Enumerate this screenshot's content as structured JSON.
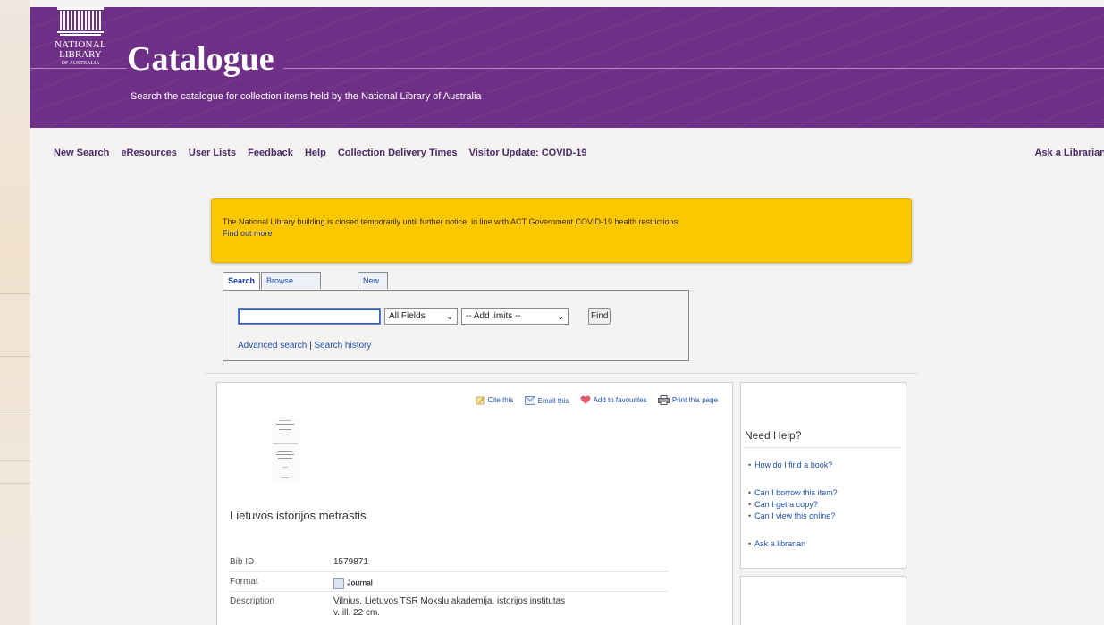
{
  "header": {
    "logo_line1": "NATIONAL",
    "logo_line2": "LIBRARY",
    "logo_line3": "OF AUSTRALIA",
    "title": "Catalogue",
    "subtitle": "Search the catalogue for collection items held by the National Library of Australia"
  },
  "nav": {
    "items": [
      "New Search",
      "eResources",
      "User Lists",
      "Feedback",
      "Help",
      "Collection Delivery Times",
      "Visitor Update: COVID-19"
    ],
    "right": "Ask a Librarian"
  },
  "alert": {
    "message": "The National Library building is closed temporarily until further notice, in line with ACT Government COVID-19 health restrictions.",
    "link": "Find out more"
  },
  "search": {
    "tabs": [
      "Search",
      "Browse alphabetically",
      "New items"
    ],
    "input_value": "",
    "field_select": "All Fields",
    "limits_select": "-- Add limits --",
    "find_label": "Find",
    "advanced_link": "Advanced search",
    "separator": "|",
    "history_link": "Search history"
  },
  "record": {
    "actions": [
      "Cite this",
      "Email this",
      "Add to favourites",
      "Print this page"
    ],
    "title": "Lietuvos istorijos metrastis",
    "fields": {
      "bib_label": "Bib ID",
      "bib_value": "1579871",
      "format_label": "Format",
      "format_value": "Journal",
      "desc_label": "Description",
      "desc_line1": "Vilnius, Lietuvos TSR Mokslu akademija, istorijos institutas",
      "desc_line2": "v. ill. 22 cm."
    }
  },
  "help": {
    "title": "Need Help?",
    "items": [
      "How do I find a book?",
      "Can I borrow this item?",
      "Can I get a copy?",
      "Can I view this online?",
      "Ask a librarian"
    ]
  },
  "colors": {
    "banner": "#6e2f86",
    "alert": "#fdc800",
    "link": "#2050b0",
    "nav": "#4a2868"
  }
}
